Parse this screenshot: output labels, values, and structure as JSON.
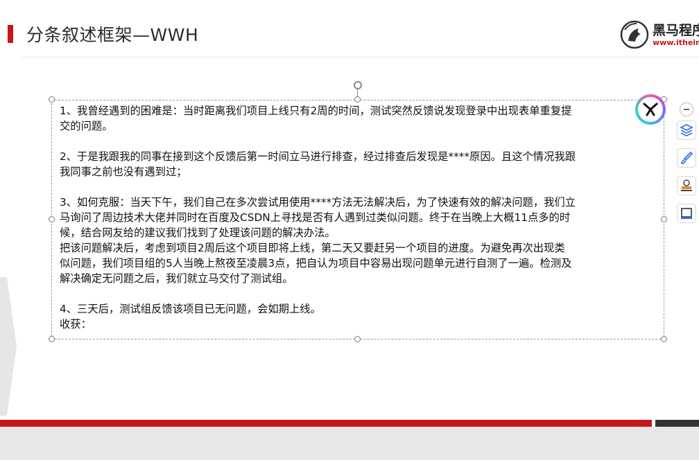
{
  "slide": {
    "title": "分条叙述框架—WWH",
    "logo": {
      "text": "黑马程序",
      "url": "www.itheima"
    }
  },
  "textbox": {
    "paragraphs": [
      [
        "1、我曾经遇到的困难是：当时距离我们项目上线只有2周的时间，测试突然反馈说发现登录中出现表单重复提",
        "交的问题。"
      ],
      [
        "2、于是我跟我的同事在接到这个反馈后第一时间立马进行排查，经过排查后发现是****原因。且这个情况我跟",
        "我同事之前也没有遇到过；"
      ],
      [
        "3、如何克服：当天下午，我们自己在多次尝试用使用****方法无法解决后，为了快速有效的解决问题，我们立",
        "马询问了周边技术大佬并同时在百度及CSDN上寻找是否有人遇到过类似问题。终于在当晚上大概11点多的时",
        "候，结合网友给的建议我们找到了处理该问题的解决办法。",
        "把该问题解决后，考虑到项目2周后这个项目即将上线，第二天又要赶另一个项目的进度。为避免再次出现类",
        "似问题，我们项目组的5人当晚上熬夜至凌晨3点，把自认为项目中容易出现问题单元进行自测了一遍。检测及",
        "解决确定无问题之后，我们就立马交付了测试组。"
      ],
      [
        "4、三天后，测试组反馈该项目已无问题，会如期上线。",
        "收获："
      ]
    ]
  },
  "toolbar": {
    "buttons": [
      {
        "name": "layers-button",
        "icon": "layers-icon"
      },
      {
        "name": "brush-button",
        "icon": "brush-icon"
      },
      {
        "name": "stamp-button",
        "icon": "stamp-icon"
      },
      {
        "name": "frame-button",
        "icon": "frame-icon"
      }
    ]
  },
  "colors": {
    "accent": "#c8161d",
    "footer_dark": "#333333",
    "footer_gray": "#e7e7e7",
    "tool_blue": "#2f6bdc"
  }
}
